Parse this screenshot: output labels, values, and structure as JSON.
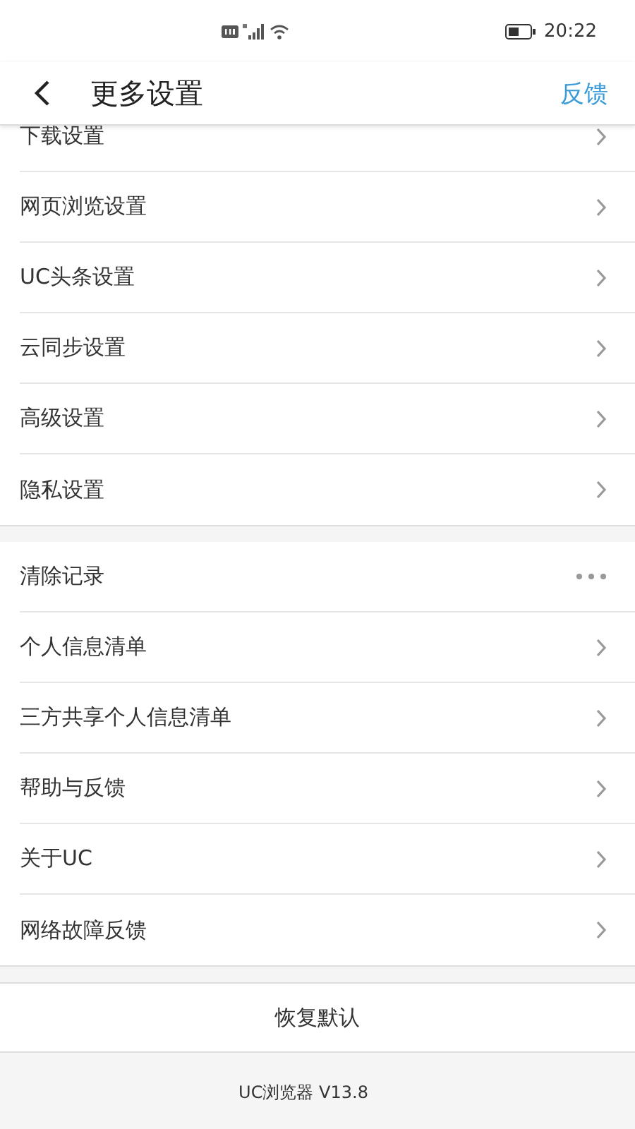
{
  "status_bar": {
    "time": "20:22"
  },
  "header": {
    "title": "更多设置",
    "action": "反馈"
  },
  "groups": [
    {
      "items": [
        {
          "label": "下载设置",
          "kind": "chevron"
        },
        {
          "label": "网页浏览设置",
          "kind": "chevron"
        },
        {
          "label": "UC头条设置",
          "kind": "chevron"
        },
        {
          "label": "云同步设置",
          "kind": "chevron"
        },
        {
          "label": "高级设置",
          "kind": "chevron"
        },
        {
          "label": "隐私设置",
          "kind": "chevron"
        }
      ]
    },
    {
      "items": [
        {
          "label": "清除记录",
          "kind": "more"
        },
        {
          "label": "个人信息清单",
          "kind": "chevron"
        },
        {
          "label": "三方共享个人信息清单",
          "kind": "chevron"
        },
        {
          "label": "帮助与反馈",
          "kind": "chevron"
        },
        {
          "label": "关于UC",
          "kind": "chevron"
        },
        {
          "label": "网络故障反馈",
          "kind": "chevron"
        }
      ]
    }
  ],
  "reset_button": "恢复默认",
  "footer": {
    "version": "UC浏览器 V13.8"
  }
}
